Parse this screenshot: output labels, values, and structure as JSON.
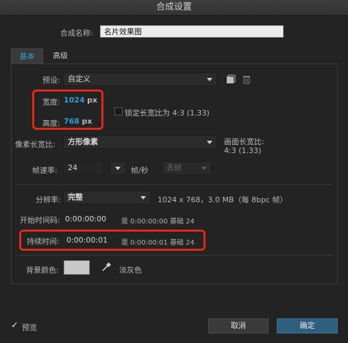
{
  "window": {
    "title": "合成设置"
  },
  "comp_name": {
    "label": "合成名称:",
    "value": "名片效果图"
  },
  "tabs": {
    "basic": "基本",
    "advanced": "高级"
  },
  "preset": {
    "label": "预设:",
    "value": "自定义"
  },
  "width": {
    "label": "宽度:",
    "value": "1024",
    "unit": "px"
  },
  "height": {
    "label": "高度:",
    "value": "768",
    "unit": "px"
  },
  "lock_aspect": {
    "label": "锁定长宽比为 4:3 (1.33)",
    "checked": false
  },
  "pixel_aspect": {
    "label": "像素长宽比:",
    "value": "方形像素"
  },
  "frame_aspect": {
    "label": "画面长宽比:",
    "value": "4:3 (1.33)"
  },
  "frame_rate": {
    "label": "帧速率:",
    "value": "24",
    "unit": "帧/秒",
    "drop_frame": "丢帧"
  },
  "resolution": {
    "label": "分辨率:",
    "value": "完整",
    "info": "1024 x 768，3.0 MB（每 8bpc 帧）"
  },
  "start_timecode": {
    "label": "开始时间码:",
    "value": "0:00:00:00",
    "note": "是 0:00:00:00  基础 24"
  },
  "duration": {
    "label": "持续时间:",
    "value": "0:00:00:01",
    "note": "是 0:00:00:01  基础 24"
  },
  "background": {
    "label": "背景颜色:",
    "color": "#c8c8c8",
    "name": "淡灰色"
  },
  "footer": {
    "preview_label": "预览",
    "preview_checked": true,
    "cancel": "取消",
    "ok": "确定"
  },
  "colors": {
    "accent": "#2e9fd8",
    "highlight": "#e8261a",
    "primary_button": "#2f5f7f"
  },
  "icons": {
    "new_preset": "new-preset-icon",
    "delete_preset": "trash-icon",
    "eyedropper": "eyedropper-icon"
  }
}
